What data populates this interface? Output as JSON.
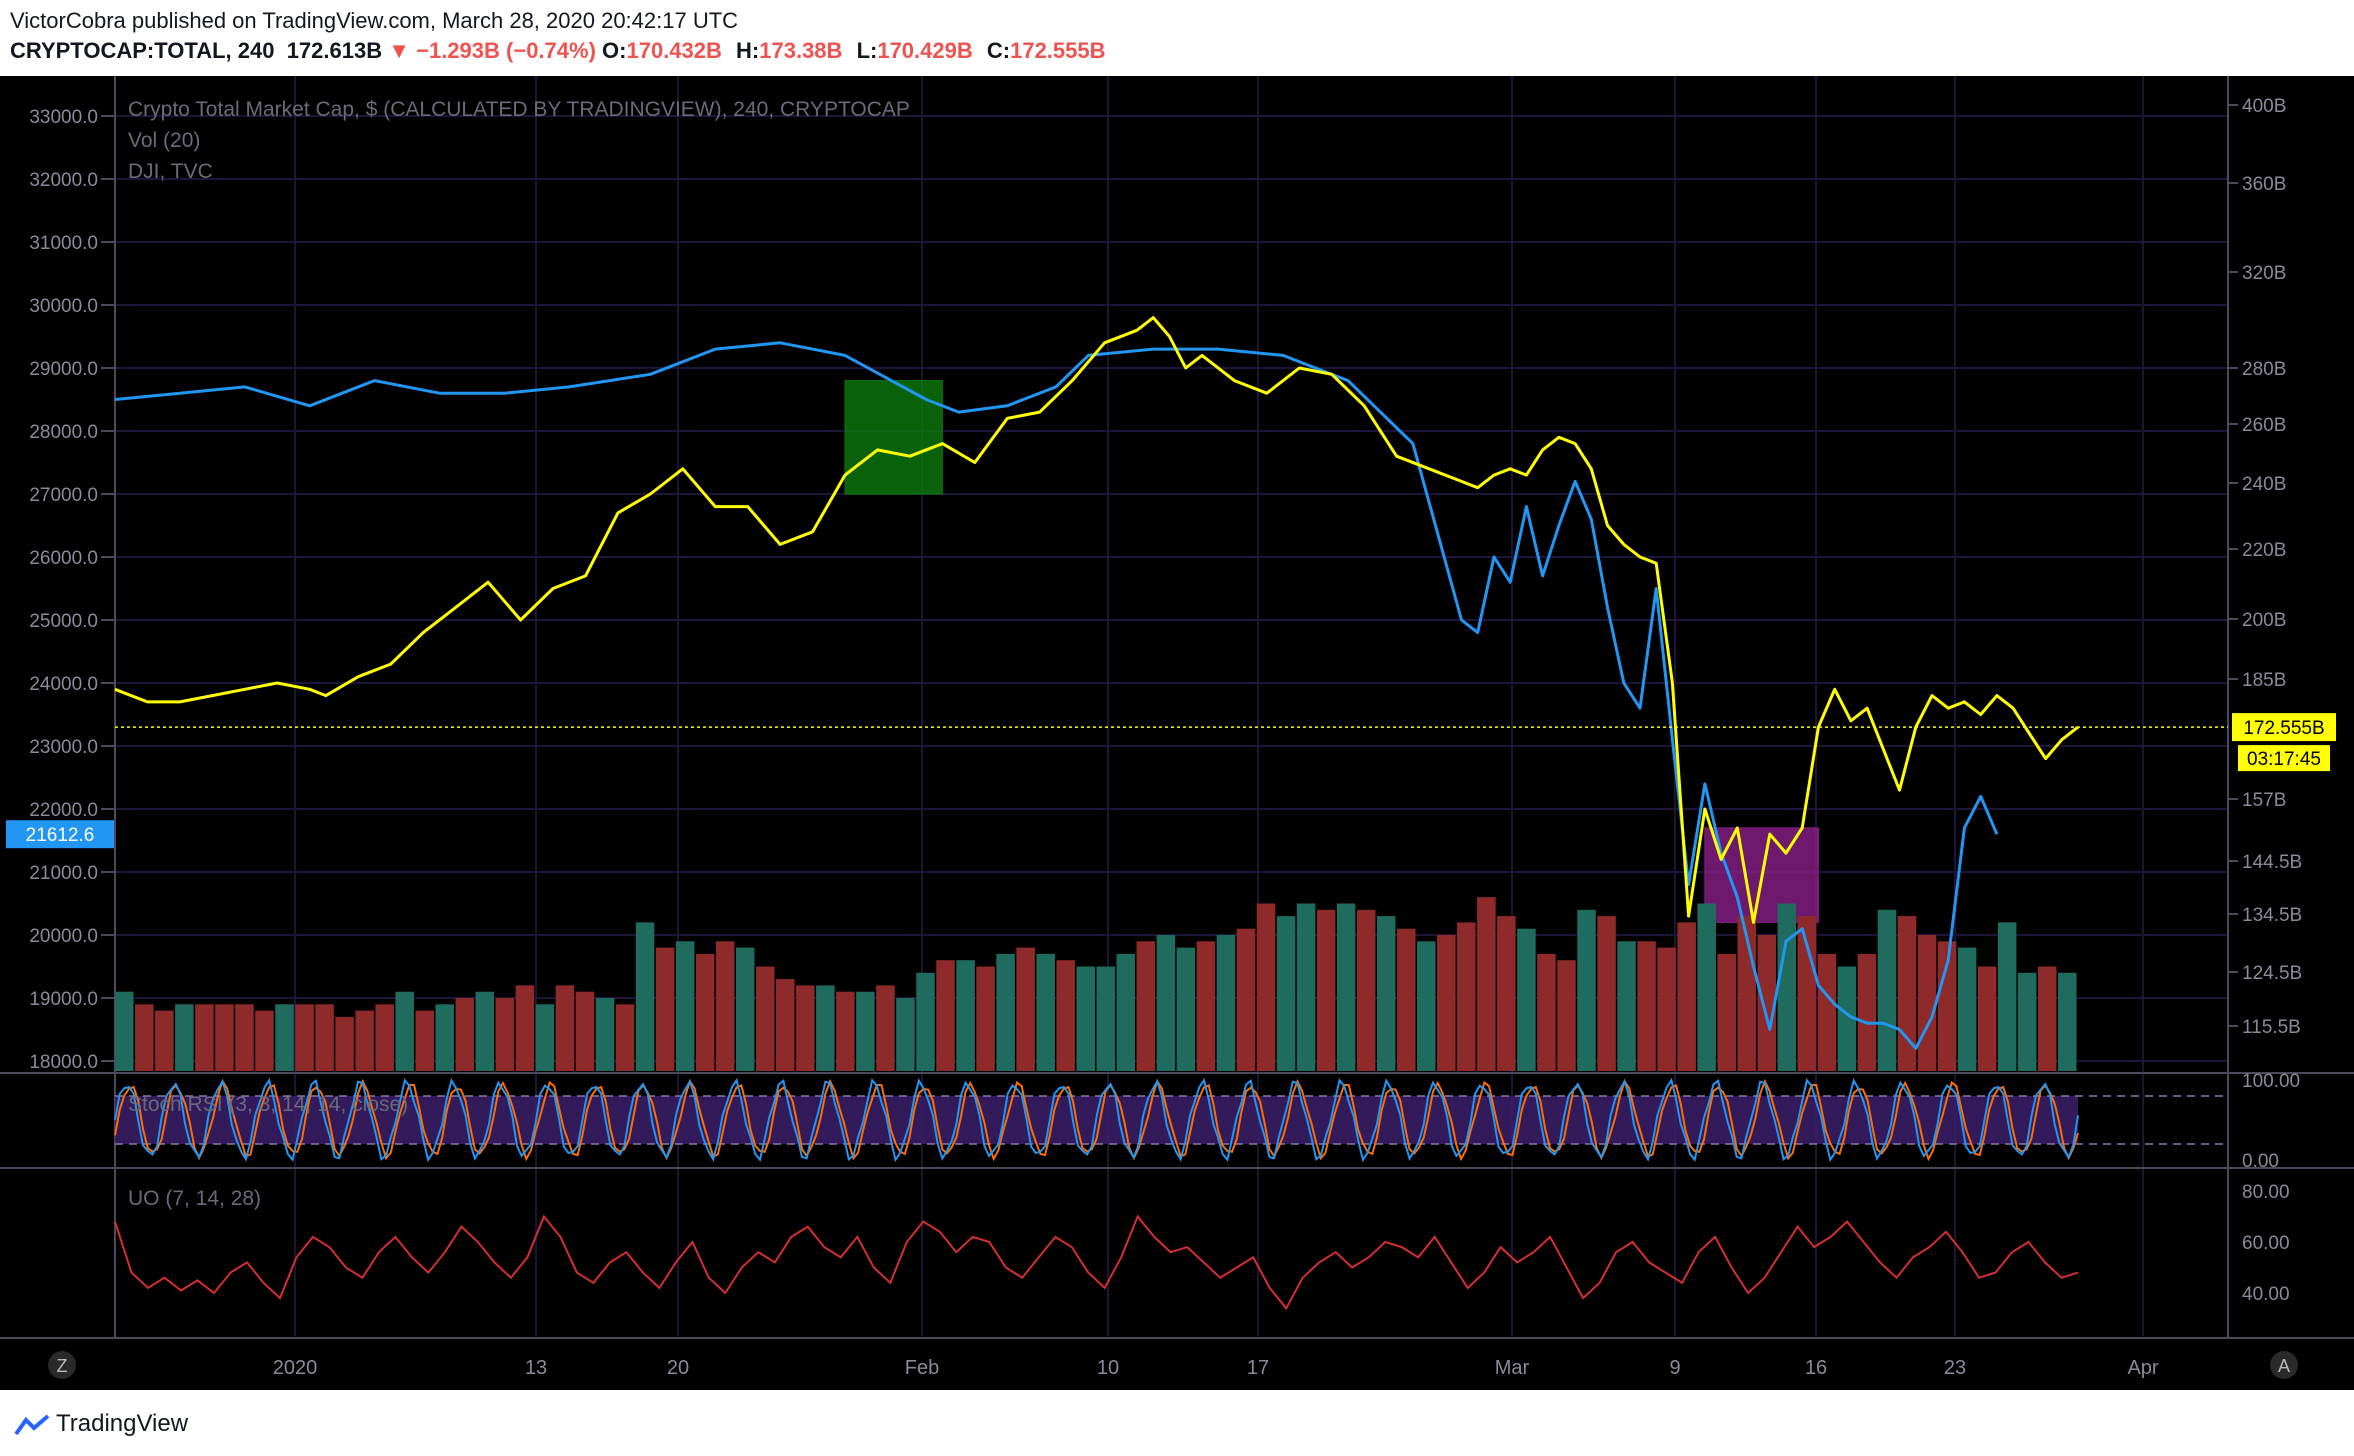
{
  "header": {
    "publisher_line": "VictorCobra published on TradingView.com, March 28, 2020 20:42:17 UTC",
    "symbol": "CRYPTOCAP:TOTAL, 240",
    "last": "172.613B",
    "change": "▼ −1.293B (−0.74%)",
    "o_label": "O:",
    "o_value": "170.432B",
    "h_label": "H:",
    "h_value": "173.38B",
    "l_label": "L:",
    "l_value": "170.429B",
    "c_label": "C:",
    "c_value": "172.555B"
  },
  "legend": {
    "main": "Crypto Total Market Cap, $ (CALCULATED BY TRADINGVIEW), 240, CRYPTOCAP",
    "vol": "Vol (20)",
    "dji": "DJI, TVC",
    "stoch": "Stoch RSI (3, 3, 14, 14, close)",
    "uo": "UO (7, 14, 28)"
  },
  "footer": {
    "brand": "TradingView",
    "left_button": "Z",
    "right_button": "A"
  },
  "colors": {
    "background": "#000000",
    "crypto_line": "#ffff00",
    "dji_line": "#2196f3",
    "vol_up": "#1f6b5e",
    "vol_down": "#8f2a2a",
    "uo_line": "#d32f2f",
    "stoch_k": "#2196f3",
    "stoch_d": "#ff6d00",
    "green_box": "#0b7a0b",
    "purple_box": "#8a1f8a",
    "grid": "#1d1438"
  },
  "chart_data": [
    {
      "type": "line",
      "title": "Crypto Total Market Cap, $ (CALCULATED BY TRADINGVIEW), 240, CRYPTOCAP",
      "x_ticks": [
        "2020",
        "13",
        "20",
        "Feb",
        "10",
        "17",
        "Mar",
        "9",
        "16",
        "23",
        "Apr"
      ],
      "right_axis_ticks": [
        "400B",
        "360B",
        "320B",
        "280B",
        "260B",
        "240B",
        "220B",
        "200B",
        "185B",
        "157B",
        "144.5B",
        "134.5B",
        "124.5B",
        "115.5B"
      ],
      "left_axis_ticks": [
        "33000.0",
        "32000.0",
        "31000.0",
        "30000.0",
        "29000.0",
        "28000.0",
        "27000.0",
        "26000.0",
        "25000.0",
        "24000.0",
        "23000.0",
        "22000.0",
        "21000.0",
        "20000.0",
        "19000.0",
        "18000.0"
      ],
      "last_price_label": "172.555B",
      "countdown_label": "03:17:45",
      "dji_last_label": "21612.6",
      "series": [
        {
          "name": "Crypto Total Market Cap",
          "x": [
            0,
            2,
            4,
            6,
            8,
            10,
            12,
            13,
            15,
            17,
            19,
            21,
            23,
            25,
            27,
            29,
            31,
            33,
            35,
            37,
            39,
            41,
            43,
            45,
            47,
            49,
            51,
            53,
            55,
            57,
            59,
            61,
            63,
            64,
            65,
            66,
            67,
            69,
            71,
            73,
            75,
            77,
            79,
            81,
            83,
            84,
            85,
            86,
            87,
            88,
            89,
            90,
            91,
            92,
            93,
            94,
            95,
            96,
            97,
            98,
            99,
            100,
            101,
            102,
            103,
            104,
            105,
            106,
            107,
            108,
            110,
            111,
            112,
            113,
            114,
            115,
            116,
            117,
            118,
            119,
            120,
            121
          ],
          "values": [
            23.9,
            23.7,
            23.7,
            23.8,
            23.9,
            24.0,
            23.9,
            23.8,
            24.1,
            24.3,
            24.8,
            25.2,
            25.6,
            25.0,
            25.5,
            25.7,
            26.7,
            27.0,
            27.4,
            26.8,
            26.8,
            26.2,
            26.4,
            27.3,
            27.7,
            27.6,
            27.8,
            27.5,
            28.2,
            28.3,
            28.8,
            29.4,
            29.6,
            29.8,
            29.5,
            29.0,
            29.2,
            28.8,
            28.6,
            29.0,
            28.9,
            28.4,
            27.6,
            27.4,
            27.2,
            27.1,
            27.3,
            27.4,
            27.3,
            27.7,
            27.9,
            27.8,
            27.4,
            26.5,
            26.2,
            26.0,
            25.9,
            24.0,
            20.3,
            22.0,
            21.2,
            21.7,
            20.2,
            21.6,
            21.3,
            21.7,
            23.3,
            23.9,
            23.4,
            23.6,
            22.3,
            23.3,
            23.8,
            23.6,
            23.7,
            23.5,
            23.8,
            23.6,
            23.2,
            22.8,
            23.1,
            23.3
          ],
          "unit": "DJI-scale (thousands)"
        },
        {
          "name": "DJI, TVC",
          "x": [
            0,
            4,
            8,
            12,
            14,
            16,
            20,
            24,
            28,
            33,
            37,
            41,
            45,
            50,
            52,
            55,
            58,
            60,
            64,
            68,
            72,
            76,
            80,
            83,
            84,
            85,
            86,
            87,
            88,
            89,
            90,
            91,
            92,
            93,
            94,
            95,
            96,
            97,
            98,
            99,
            100,
            101,
            102,
            103,
            104,
            105,
            106,
            107,
            108,
            109,
            110,
            111,
            112,
            113,
            114,
            115,
            116
          ],
          "values": [
            28.5,
            28.6,
            28.7,
            28.4,
            28.6,
            28.8,
            28.6,
            28.6,
            28.7,
            28.9,
            29.3,
            29.4,
            29.2,
            28.5,
            28.3,
            28.4,
            28.7,
            29.2,
            29.3,
            29.3,
            29.2,
            28.8,
            27.8,
            25.0,
            24.8,
            26.0,
            25.6,
            26.8,
            25.7,
            26.5,
            27.2,
            26.6,
            25.2,
            24.0,
            23.6,
            25.5,
            23.1,
            20.8,
            22.4,
            21.3,
            20.6,
            19.5,
            18.5,
            19.9,
            20.1,
            19.2,
            18.9,
            18.7,
            18.6,
            18.6,
            18.5,
            18.2,
            18.7,
            19.6,
            21.7,
            22.2,
            21.6
          ],
          "unit": "thousands"
        }
      ],
      "annotations": [
        {
          "type": "box",
          "label": "green-box",
          "x_range": [
            45,
            51
          ],
          "y_range": [
            27.0,
            28.8
          ]
        },
        {
          "type": "box",
          "label": "purple-box",
          "x_range": [
            98,
            105
          ],
          "y_range": [
            20.2,
            21.7
          ]
        }
      ]
    },
    {
      "type": "bar",
      "title": "Vol (20)",
      "values": [
        19.1,
        18.9,
        18.8,
        18.9,
        18.9,
        18.9,
        18.9,
        18.8,
        18.9,
        18.9,
        18.9,
        18.7,
        18.8,
        18.9,
        19.1,
        18.8,
        18.9,
        19.0,
        19.1,
        19.0,
        19.2,
        18.9,
        19.2,
        19.1,
        19.0,
        18.9,
        20.2,
        19.8,
        19.9,
        19.7,
        19.9,
        19.8,
        19.5,
        19.3,
        19.2,
        19.2,
        19.1,
        19.1,
        19.2,
        19.0,
        19.4,
        19.6,
        19.6,
        19.5,
        19.7,
        19.8,
        19.7,
        19.6,
        19.5,
        19.5,
        19.7,
        19.9,
        20.0,
        19.8,
        19.9,
        20.0,
        20.1,
        20.5,
        20.3,
        20.5,
        20.4,
        20.5,
        20.4,
        20.3,
        20.1,
        19.9,
        20.0,
        20.2,
        20.6,
        20.3,
        20.1,
        19.7,
        19.6,
        20.4,
        20.3,
        19.9,
        19.9,
        19.8,
        20.2,
        20.5,
        19.7,
        20.3,
        20.0,
        20.5,
        20.3,
        19.7,
        19.5,
        19.7,
        20.4,
        20.3,
        20.0,
        19.9,
        19.8,
        19.5,
        20.2,
        19.4,
        19.5,
        19.4
      ],
      "colors": [
        "up",
        "down",
        "down",
        "up",
        "down",
        "down",
        "down",
        "down",
        "up",
        "down",
        "down",
        "down",
        "down",
        "down",
        "up",
        "down",
        "up",
        "down",
        "up",
        "down",
        "down",
        "up",
        "down",
        "down",
        "up",
        "down",
        "up",
        "down",
        "up",
        "down",
        "down",
        "up",
        "down",
        "down",
        "down",
        "up",
        "down",
        "up",
        "down",
        "up",
        "up",
        "down",
        "up",
        "down",
        "up",
        "down",
        "up",
        "down",
        "up",
        "up",
        "up",
        "down",
        "up",
        "up",
        "down",
        "up",
        "down",
        "down",
        "up",
        "up",
        "down",
        "up",
        "down",
        "up",
        "down",
        "up",
        "down",
        "down",
        "down",
        "down",
        "up",
        "down",
        "down",
        "up",
        "down",
        "up",
        "down",
        "down",
        "down",
        "up",
        "down",
        "down",
        "down",
        "up",
        "down",
        "down",
        "up",
        "down",
        "up",
        "down",
        "down",
        "down",
        "up",
        "down",
        "up",
        "up",
        "down",
        "up"
      ]
    },
    {
      "type": "line",
      "title": "Stoch RSI (3, 3, 14, 14, close)",
      "y_ticks": [
        "100.00",
        "0.00"
      ],
      "band": [
        20,
        80
      ],
      "cycle_count": 42
    },
    {
      "type": "line",
      "title": "UO (7, 14, 28)",
      "y_ticks": [
        "80.00",
        "60.00",
        "40.00"
      ],
      "values": [
        68,
        48,
        42,
        46,
        41,
        45,
        40,
        48,
        52,
        44,
        38,
        54,
        62,
        58,
        50,
        46,
        56,
        62,
        54,
        48,
        56,
        66,
        60,
        52,
        46,
        54,
        70,
        62,
        48,
        44,
        52,
        56,
        48,
        42,
        52,
        60,
        46,
        40,
        50,
        56,
        52,
        62,
        66,
        58,
        54,
        62,
        50,
        44,
        60,
        68,
        64,
        56,
        62,
        60,
        50,
        46,
        54,
        62,
        58,
        48,
        42,
        54,
        70,
        62,
        56,
        58,
        52,
        46,
        50,
        54,
        42,
        34,
        46,
        52,
        56,
        50,
        54,
        60,
        58,
        54,
        62,
        52,
        42,
        48,
        58,
        52,
        56,
        62,
        50,
        38,
        44,
        56,
        60,
        52,
        48,
        44,
        56,
        62,
        50,
        40,
        46,
        56,
        66,
        58,
        62,
        68,
        60,
        52,
        46,
        54,
        58,
        64,
        56,
        46,
        48,
        56,
        60,
        52,
        46,
        48
      ]
    }
  ]
}
